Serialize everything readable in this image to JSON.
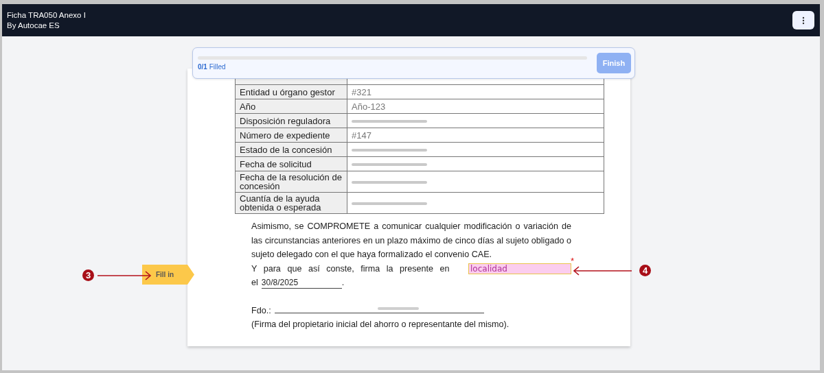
{
  "header": {
    "title": "Ficha TRA050 Anexo I",
    "subtitle": "By Autocae ES"
  },
  "progress": {
    "level": 0,
    "count": "0/1",
    "label": "Filled",
    "finish_button": {
      "label": "Finish",
      "disabled": true
    }
  },
  "table": {
    "rows": [
      {
        "label": "Entidad u órgano gestor",
        "value": "#321",
        "redacted": false
      },
      {
        "label": "Año",
        "value": "Año-123",
        "redacted": false
      },
      {
        "label": "Disposición reguladora",
        "redacted": true
      },
      {
        "label": "Número de expediente",
        "value": "#147",
        "redacted": false
      },
      {
        "label": "Estado de la concesión",
        "redacted": true
      },
      {
        "label": "Fecha de solicitud",
        "redacted": true
      },
      {
        "label": "Fecha de la resolución de concesión",
        "redacted": true
      },
      {
        "label": "Cuantía de la ayuda obtenida o esperada",
        "redacted": true
      }
    ]
  },
  "text": {
    "paragraph": "Asimismo, se COMPROMETE a comunicar cualquier modificación o variación de las circunstancias anteriores en un plazo máximo de cinco días al sujeto obligado o sujeto delegado con el que haya formalizado el convenio CAE.",
    "place_prefix": "Y para que así conste, firma la presente en",
    "place_field": {
      "placeholder": "localidad",
      "required_mark": "*"
    },
    "date_prefix": "el",
    "date": "30/8/2025",
    "date_suffix": ".",
    "signature_prefix": "Fdo.:",
    "signature_redacted": true,
    "signature_note": "(Firma del propietario inicial del ahorro o representante del mismo)."
  },
  "fill_in_tag": "Fill in",
  "annotations": [
    {
      "number": "3",
      "kind": "right-arrow"
    },
    {
      "number": "4",
      "kind": "left-arrow"
    }
  ]
}
